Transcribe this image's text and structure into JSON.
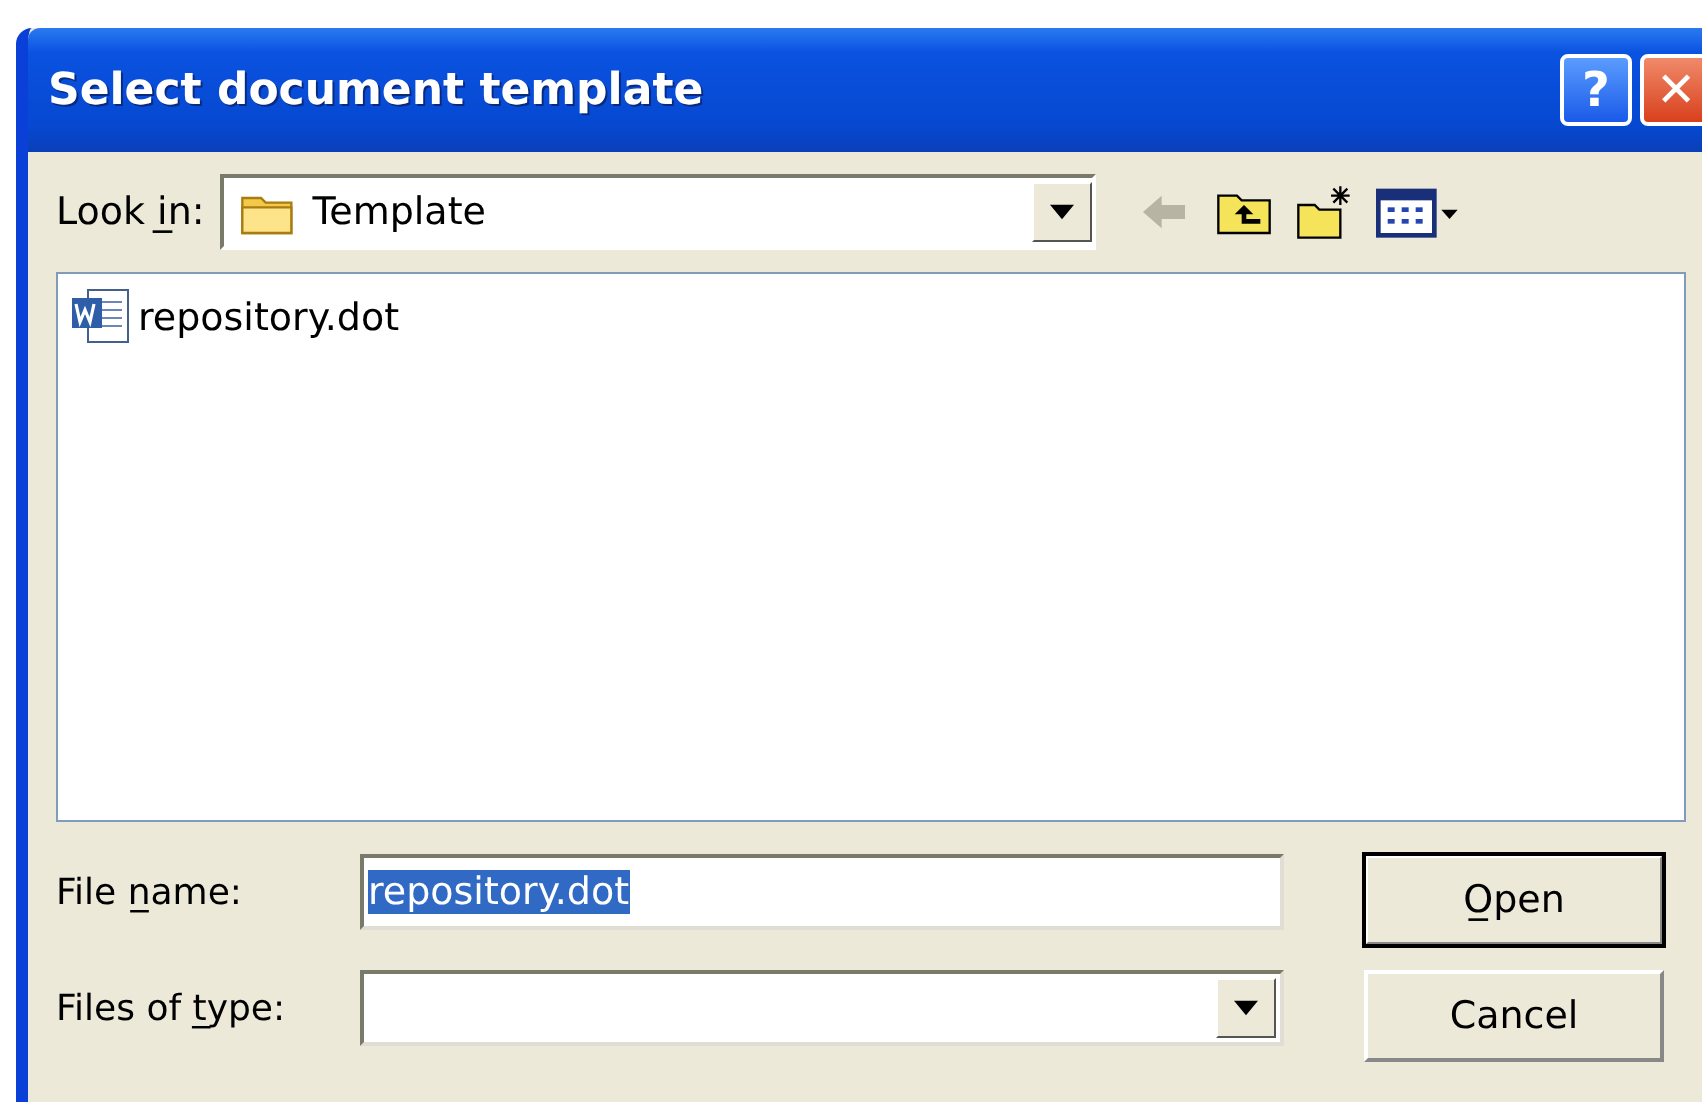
{
  "window": {
    "title": "Select document template",
    "buttons": [
      {
        "kind": "help",
        "label": "?"
      },
      {
        "kind": "close",
        "label": "✕"
      }
    ]
  },
  "look_in": {
    "label": "Look i̲n:",
    "value": "Template"
  },
  "toolbar": [
    {
      "kind": "back",
      "disabled": true
    },
    {
      "kind": "up",
      "disabled": false
    },
    {
      "kind": "new-folder",
      "disabled": false
    },
    {
      "kind": "view",
      "disabled": false
    }
  ],
  "files": [
    {
      "name": "repository.dot",
      "selected": false
    }
  ],
  "file_name": {
    "label": "File n̲ame:",
    "value": "repository.dot",
    "value_selected": true
  },
  "file_type": {
    "label": "Files of t̲ype:"
  },
  "buttons": [
    {
      "label": "O̲pen",
      "default": true
    },
    {
      "label": "Cancel",
      "default": false
    }
  ]
}
